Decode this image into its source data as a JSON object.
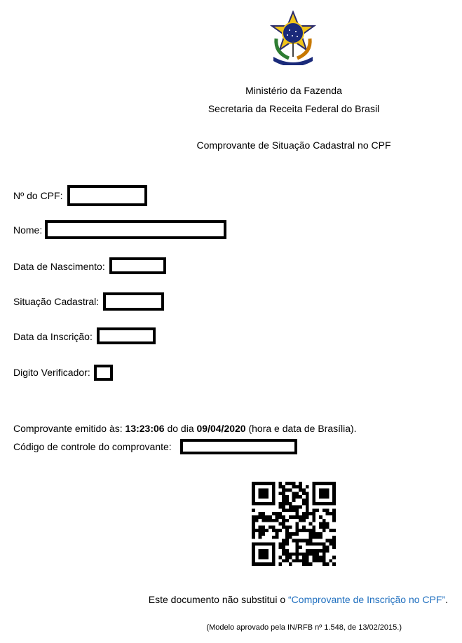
{
  "header": {
    "ministry": "Ministério da Fazenda",
    "secretariat": "Secretaria da Receita Federal do Brasil",
    "document_title": "Comprovante de Situação Cadastral no CPF",
    "emblem_icon": "brazil-coat-of-arms-icon"
  },
  "fields": {
    "cpf_label": "Nº do CPF:",
    "cpf_value": "",
    "name_label": "Nome:",
    "name_value": "",
    "birth_label": "Data de Nascimento:",
    "birth_value": "",
    "status_label": "Situação Cadastral:",
    "status_value": "",
    "registration_label": "Data da Inscrição:",
    "registration_value": "",
    "check_digit_label": "Digito Verificador:",
    "check_digit_value": ""
  },
  "issuance": {
    "prefix": "Comprovante emitido às: ",
    "time": "13:23:06",
    "middle": " do dia ",
    "date": "09/04/2020",
    "suffix": " (hora e data de Brasília).",
    "control_label": "Código de controle do comprovante:",
    "control_value": ""
  },
  "qr_code": {
    "icon": "qr-code-icon"
  },
  "footer": {
    "note_prefix": "Este documento não substitui o ",
    "note_link": "“Comprovante de Inscrição no CPF”",
    "note_suffix": ".",
    "model_note": "(Modelo aprovado pela IN/RFB nº 1.548, de 13/02/2015.)"
  },
  "colors": {
    "link": "#1f6fbf",
    "redaction_border": "#000000"
  }
}
